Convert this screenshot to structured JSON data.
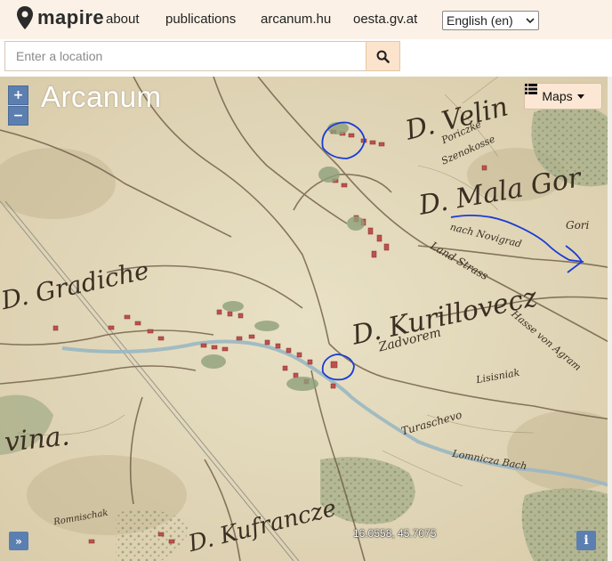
{
  "header": {
    "brand": "mapire",
    "nav": [
      {
        "label": "about"
      },
      {
        "label": "publications"
      },
      {
        "label": "arcanum.hu"
      },
      {
        "label": "oesta.gv.at"
      }
    ],
    "language": "English (en)"
  },
  "search": {
    "placeholder": "Enter a location"
  },
  "map": {
    "watermark": "Arcanum",
    "zoom_in": "+",
    "zoom_out": "−",
    "layers_button": "Maps",
    "coordinates": "16.0558, 45.7075",
    "expand_label": "»",
    "info_label": "i",
    "places": [
      {
        "text": "D. Velin"
      },
      {
        "text": "D. Mala Gor"
      },
      {
        "text": "D. Gradiche"
      },
      {
        "text": "D. Kurillovecz"
      },
      {
        "text": "D. Kufrancze"
      },
      {
        "text": "vina."
      },
      {
        "text": "Zadvorem"
      },
      {
        "text": "Poriczke"
      },
      {
        "text": "Szenokosse"
      },
      {
        "text": "nach Novigrad"
      },
      {
        "text": "Land Strass"
      },
      {
        "text": "Hasse von Agram"
      },
      {
        "text": "Lisisniak"
      },
      {
        "text": "Turaschevo"
      },
      {
        "text": "Lomnicza Bach"
      },
      {
        "text": "Romnischak"
      },
      {
        "text": "Gori"
      }
    ]
  },
  "colors": {
    "header_bg": "#fbf1e6",
    "map_paper": "#e5dcc0",
    "forest": "#8fa07a",
    "river": "#9ab7c2",
    "annotation": "#1a3cd6",
    "control_blue": "#5b7fb0"
  }
}
